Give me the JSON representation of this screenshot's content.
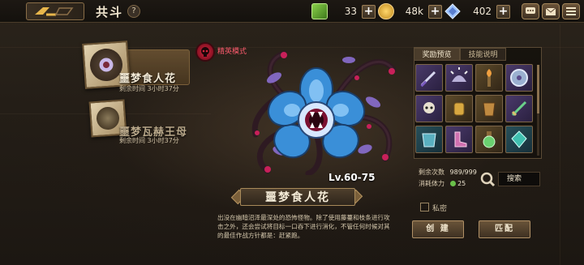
{
  "header": {
    "title": "共斗",
    "help_label": "?",
    "resources": [
      {
        "icon": "green-cube-icon",
        "value": "33"
      },
      {
        "icon": "gold-coin-icon",
        "value": "48k"
      },
      {
        "icon": "crystal-icon",
        "value": "402"
      }
    ],
    "plus_label": "+"
  },
  "boss_list": [
    {
      "name": "噩梦食人花",
      "time": "剩余时间  3小时37分",
      "selected": true
    },
    {
      "name": "噩梦瓦赫王母",
      "time": "剩余时间  3小时37分",
      "selected": false
    }
  ],
  "elite": {
    "label": "精英模式"
  },
  "monster": {
    "level": "Lv.60-75",
    "name": "噩梦食人花",
    "description": "出没在幽暗沼泽最深处的恐怖怪物。除了使用藤蔓和枝条进行攻击之外，还会尝试将目标一口吞下进行消化，不管任何时候对其的最佳作战方针都是：赶紧跑。"
  },
  "reward_panel": {
    "tabs": [
      "奖励预览",
      "技能说明"
    ],
    "active_tab": 0,
    "items": [
      {
        "icon": "dagger-icon",
        "tone": "purple"
      },
      {
        "icon": "spiked-helmet-icon",
        "tone": "purple"
      },
      {
        "icon": "flame-torch-icon",
        "tone": "gold"
      },
      {
        "icon": "round-shield-icon",
        "tone": "purple"
      },
      {
        "icon": "skull-charm-icon",
        "tone": "purple"
      },
      {
        "icon": "gold-gauntlet-icon",
        "tone": "gold"
      },
      {
        "icon": "bronze-vambrace-icon",
        "tone": "gold"
      },
      {
        "icon": "green-sword-icon",
        "tone": "purple"
      },
      {
        "icon": "teal-armor-icon",
        "tone": "teal"
      },
      {
        "icon": "pink-boots-icon",
        "tone": "purple"
      },
      {
        "icon": "green-flask-icon",
        "tone": "gold"
      },
      {
        "icon": "teal-gem-icon",
        "tone": "teal"
      }
    ]
  },
  "stats": {
    "remaining_label": "剩余次数",
    "remaining_value": "989/999",
    "stamina_label": "消耗体力",
    "stamina_value": "25"
  },
  "search": {
    "label": "搜索"
  },
  "private": {
    "label": "私密"
  },
  "buttons": {
    "create": "创 建",
    "match": "匹配"
  },
  "colors": {
    "accent": "#a88a5a",
    "elite_red": "#d2293f",
    "bg": "#241e17"
  }
}
